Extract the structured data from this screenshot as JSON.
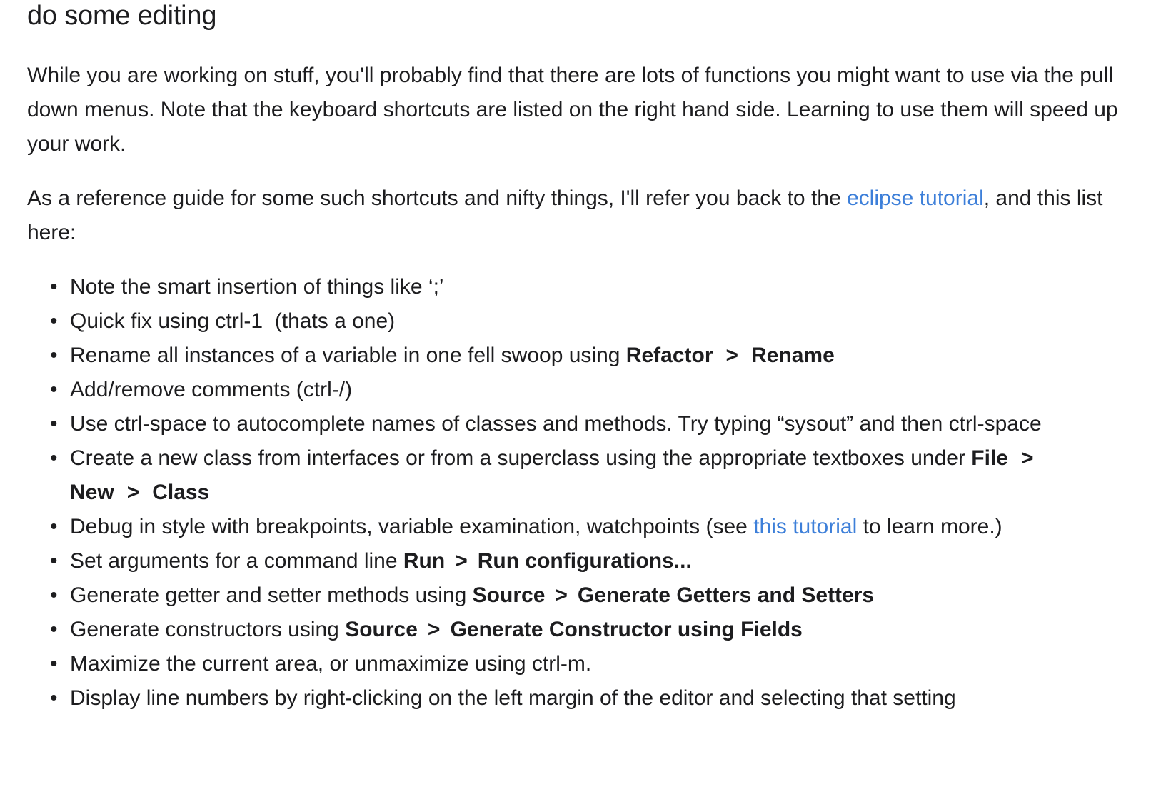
{
  "heading": "do some editing",
  "para1": "While you are working on stuff, you'll probably find that there are lots of functions you might want to use via the pull down menus. Note that the keyboard shortcuts are listed on the right hand side. Learning to use them will speed up your work.",
  "para2": {
    "before": "As a reference guide for some such shortcuts and nifty things, I'll refer you back to the ",
    "link": "eclipse tutorial",
    "after": ", and this list here:"
  },
  "separator": ">",
  "bullet": "•",
  "items": {
    "i1": {
      "text": "Note the smart insertion of things like ‘;’"
    },
    "i2": {
      "text": "Quick fix using ctrl-1  (thats a one)"
    },
    "i3": {
      "text": "Rename all instances of a variable in one fell swoop using ",
      "m1": "Refactor",
      "m2": "Rename"
    },
    "i4": {
      "text": "Add/remove comments (ctrl-/)"
    },
    "i5": {
      "text": "Use ctrl-space to autocomplete names of classes and methods. Try typing “sysout” and then ctrl-space"
    },
    "i6": {
      "text": "Create a new class from interfaces or from a superclass using the appropriate textboxes under ",
      "m1": "File",
      "m2": "New",
      "m3": "Class"
    },
    "i7": {
      "before": "Debug in style with breakpoints, variable examination, watchpoints (see ",
      "link": "this tutorial",
      "after": " to learn more.)"
    },
    "i8": {
      "text": "Set arguments for a command line ",
      "m1": "Run",
      "m2": "Run configurations..."
    },
    "i9": {
      "text": "Generate getter and setter methods using ",
      "m1": "Source",
      "m2": "Generate Getters and Setters"
    },
    "i10": {
      "text": "Generate constructors using ",
      "m1": "Source",
      "m2": "Generate Constructor using Fields"
    },
    "i11": {
      "text": "Maximize the current area, or unmaximize using ctrl-m."
    },
    "i12": {
      "text": "Display line numbers by right-clicking on the left margin of the editor and selecting that setting"
    }
  }
}
